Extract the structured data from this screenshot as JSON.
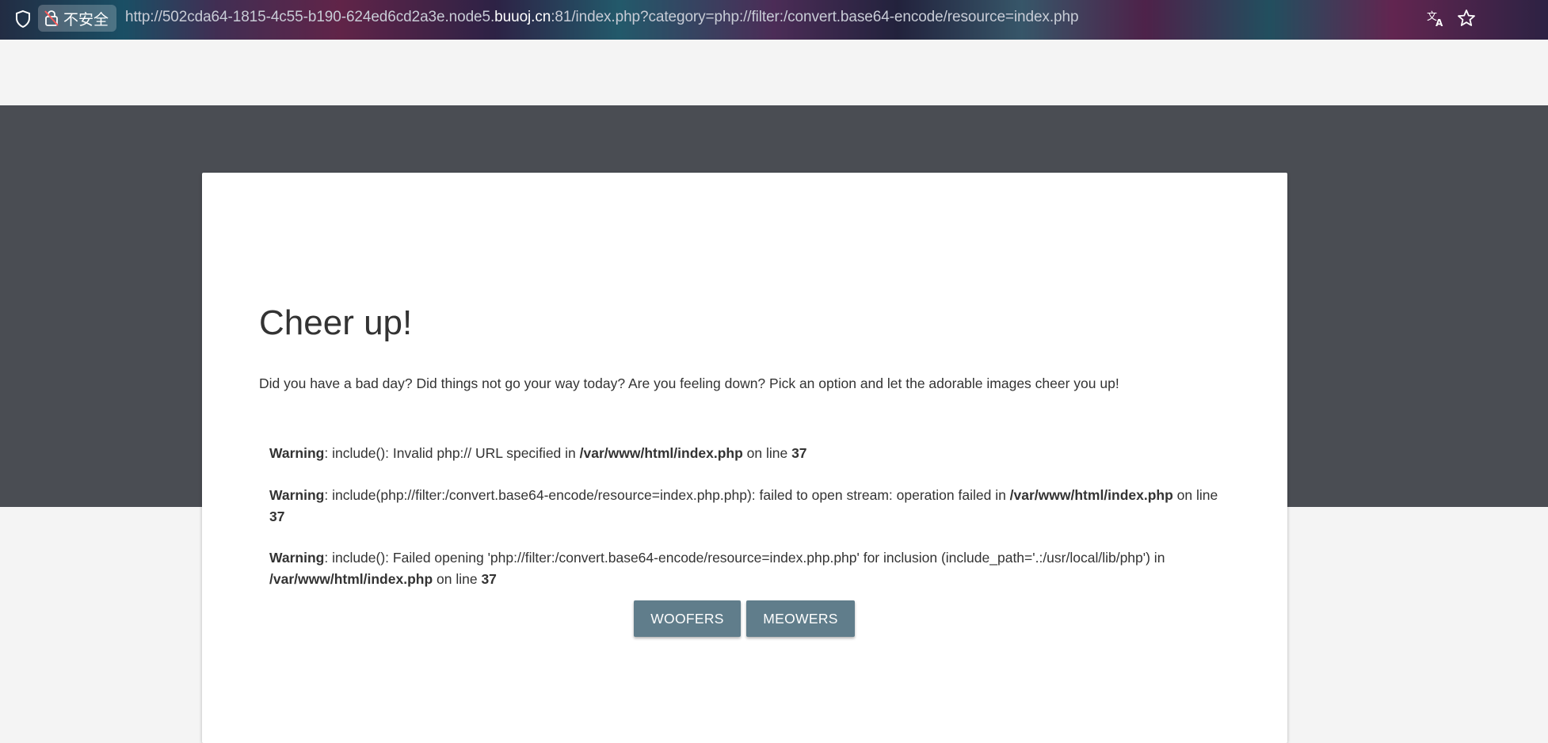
{
  "browser": {
    "security_label": "不安全",
    "url_prefix": "http://502cda64-1815-4c55-b190-624ed6cd2a3e.node5.",
    "url_host": "buuoj.cn",
    "url_suffix": ":81/index.php?category=php://filter:/convert.base64-encode/resource=index.php",
    "icons": [
      "shield-icon",
      "insecure-lock-icon",
      "translate-icon",
      "star-icon"
    ]
  },
  "page": {
    "title": "Cheer up!",
    "intro": "Did you have a bad day? Did things not go your way today? Are you feeling down? Pick an option and let the adorable images cheer you up!"
  },
  "warnings": [
    {
      "label": "Warning",
      "text1": ": include(): Invalid php:// URL specified in ",
      "path": "/var/www/html/index.php",
      "text2": " on line ",
      "line": "37"
    },
    {
      "label": "Warning",
      "text1": ": include(php://filter:/convert.base64-encode/resource=index.php.php): failed to open stream: operation failed in ",
      "path": "/var/www/html/index.php",
      "text2": " on line ",
      "line": "37"
    },
    {
      "label": "Warning",
      "text1": ": include(): Failed opening 'php://filter:/convert.base64-encode/resource=index.php.php' for inclusion (include_path='.:/usr/local/lib/php') in ",
      "path": "/var/www/html/index.php",
      "text2": " on line ",
      "line": "37"
    }
  ],
  "buttons": {
    "woofers": "WOOFERS",
    "meowers": "MEOWERS"
  },
  "colors": {
    "dark_band": "#4a4d53",
    "button": "#607d8b",
    "text": "#333333"
  }
}
